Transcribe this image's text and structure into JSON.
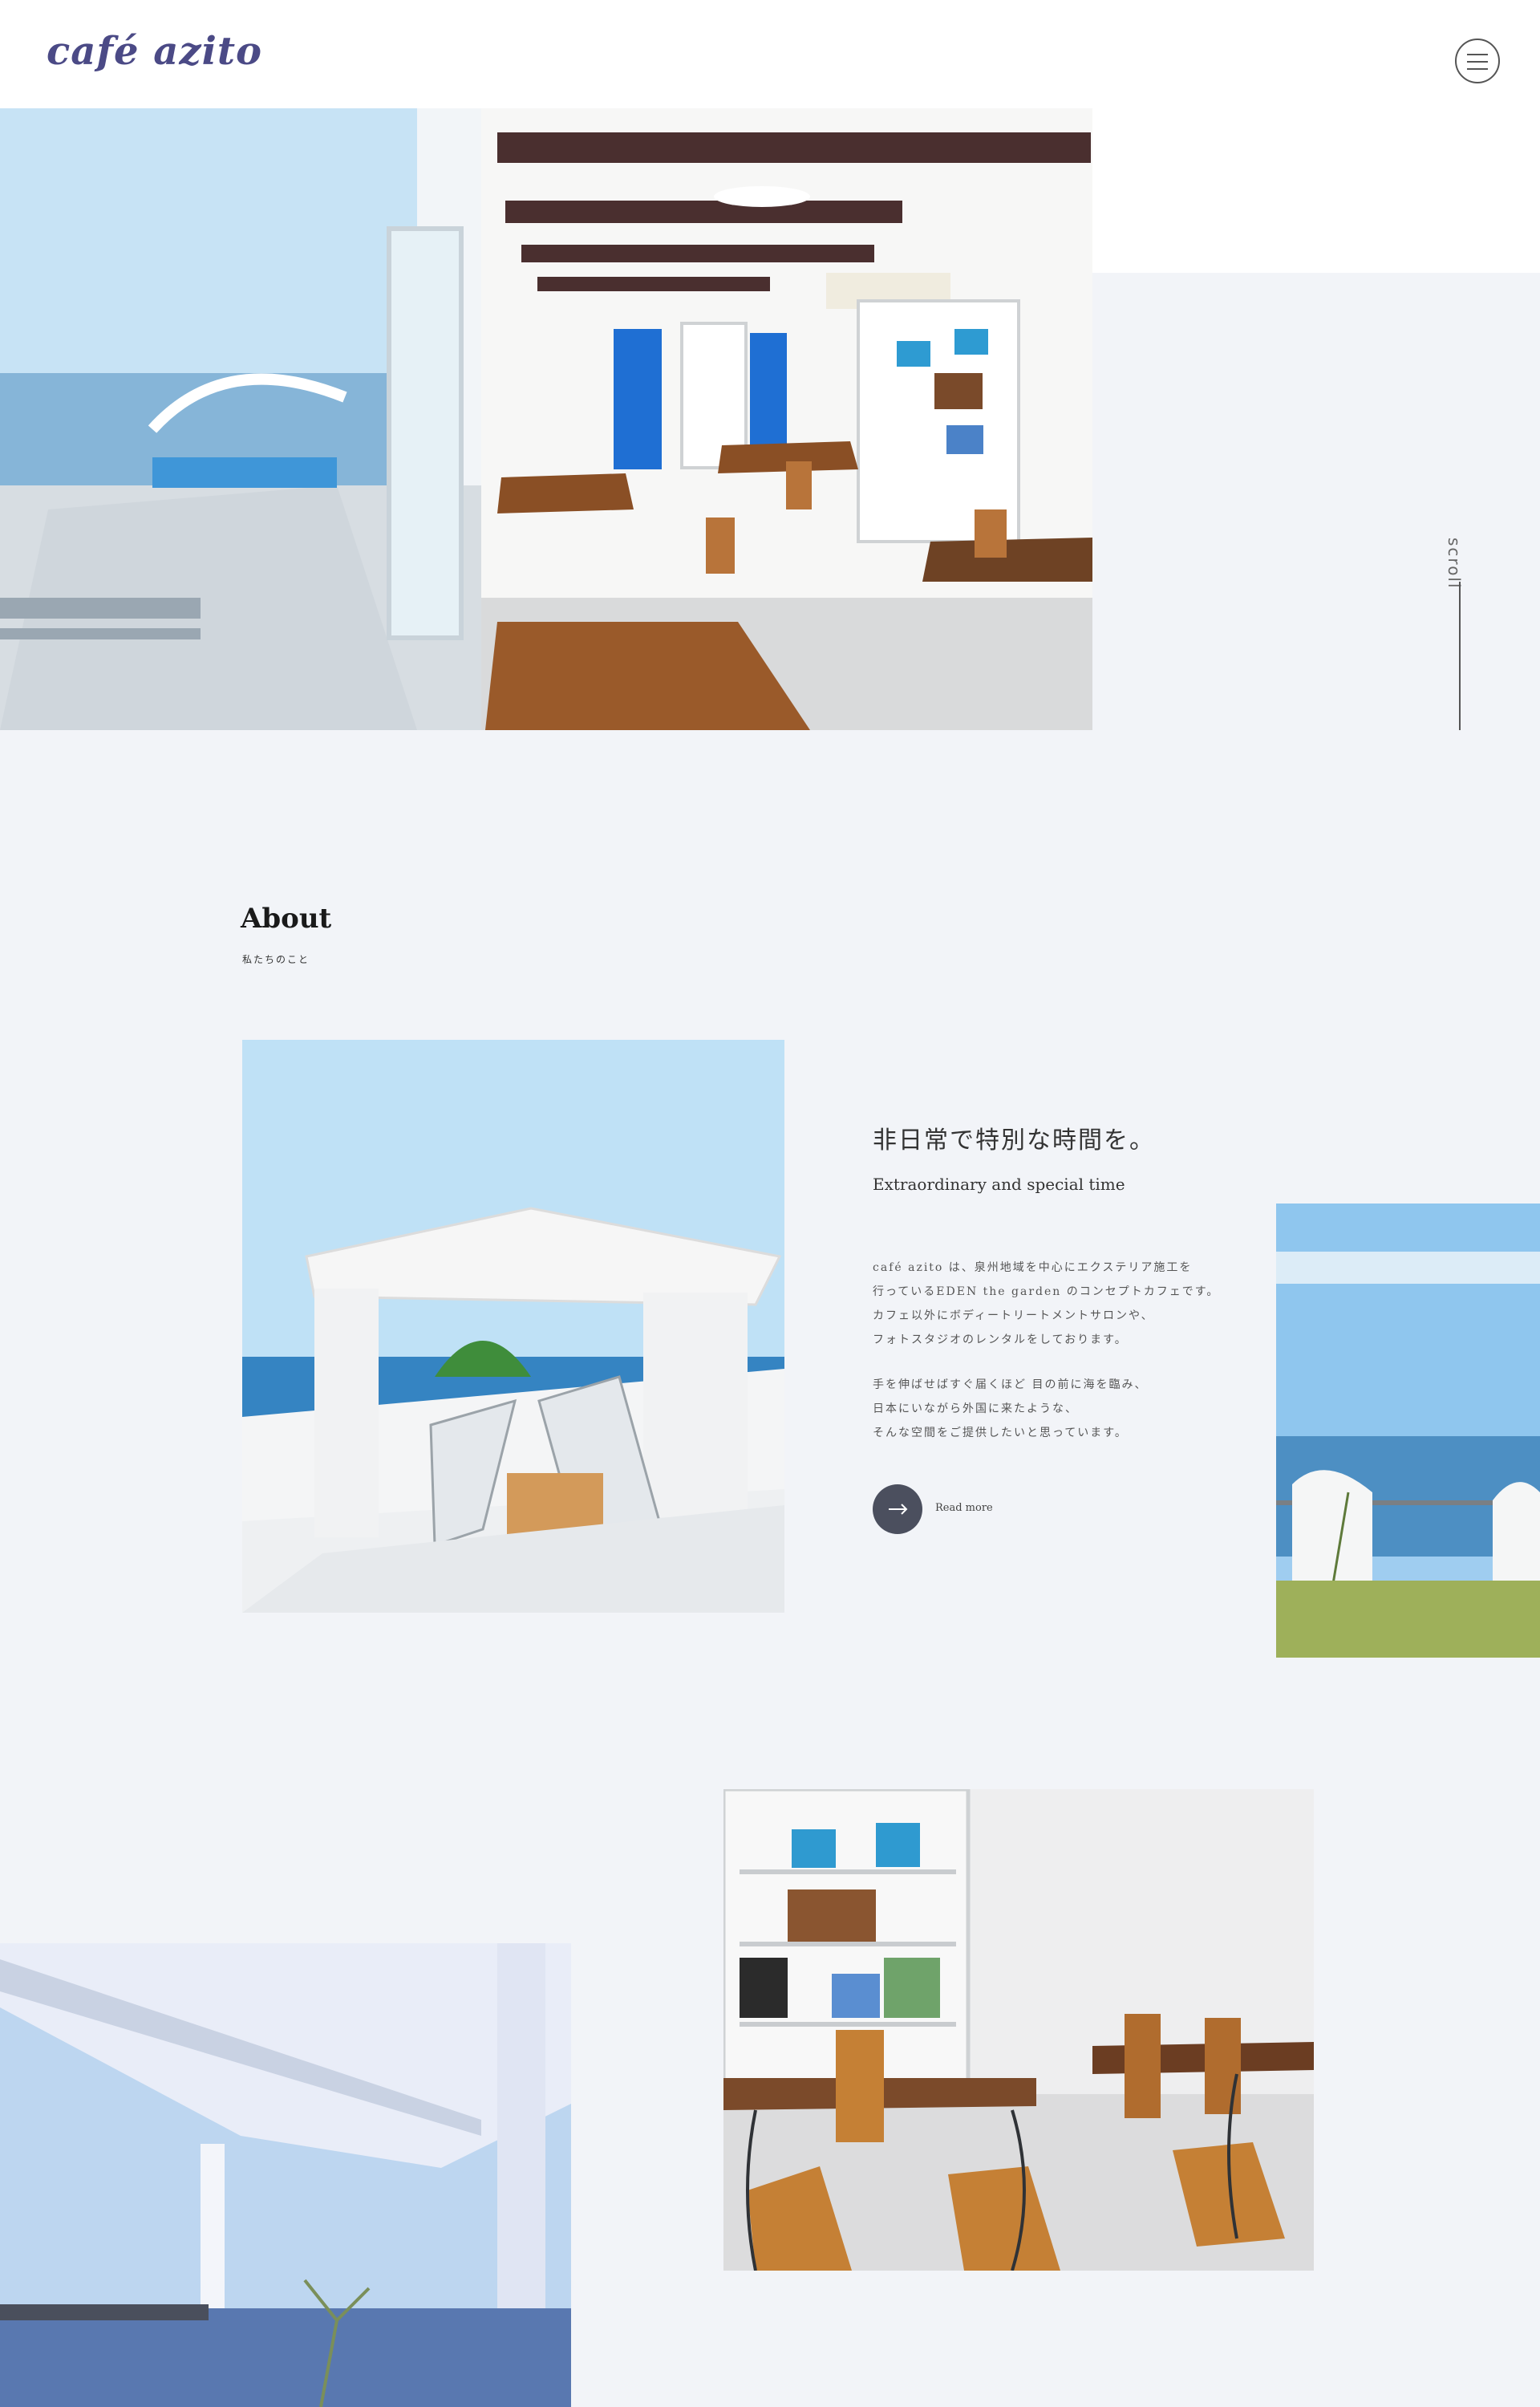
{
  "header": {
    "logo": "café azito",
    "menu_icon": "hamburger-menu-icon"
  },
  "hero": {
    "image_alt": "cafe-interior-ocean-view",
    "scroll_label": "scroll"
  },
  "about": {
    "heading": "About",
    "subheading": "私たちのこと",
    "title": "非日常で特別な時間を。",
    "title_en": "Extraordinary and special time",
    "paragraph1": [
      "café azito は、泉州地域を中心にエクステリア施工を",
      "行っているEDEN the garden のコンセプトカフェです。",
      "カフェ以外にボディートリートメントサロンや、",
      "フォトスタジオのレンタルをしております。"
    ],
    "paragraph2": [
      "手を伸ばせばすぐ届くほど 目の前に海を臨み、",
      "日本にいながら外国に来たような、",
      "そんな空間をご提供したいと思っています。"
    ],
    "read_more": "Read more",
    "arrow_icon": "arrow-right-icon"
  },
  "gallery": {
    "side_image_alt": "seaside-lawn",
    "shelf_image_alt": "cafe-bookshelf-tables",
    "canopy_image_alt": "white-canopy-sea"
  },
  "colors": {
    "background": "#f2f4f8",
    "logo": "#4b4a86",
    "button": "#4b4f5e"
  }
}
